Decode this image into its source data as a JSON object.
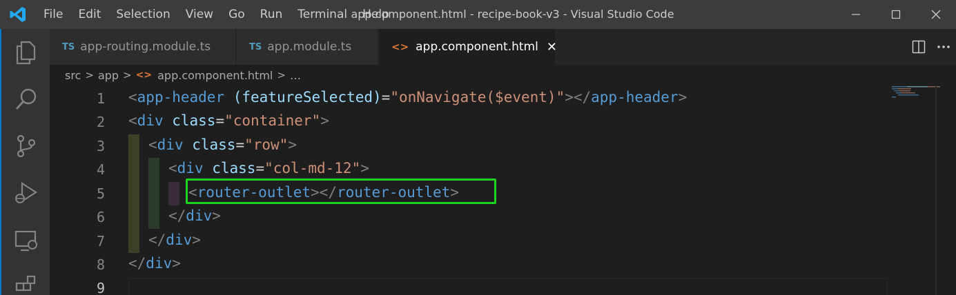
{
  "titlebar": {
    "menu": [
      "File",
      "Edit",
      "Selection",
      "View",
      "Go",
      "Run",
      "Terminal",
      "Help"
    ],
    "window_title": "app.component.html - recipe-book-v3 - Visual Studio Code",
    "controls": [
      "minimize-icon",
      "maximize-icon",
      "close-icon"
    ]
  },
  "activitybar": [
    "explorer-icon",
    "search-icon",
    "source-control-icon",
    "run-debug-icon",
    "remote-explorer-icon",
    "extensions-icon"
  ],
  "tabs": [
    {
      "type": "TS",
      "label": "app-routing.module.ts",
      "active": false
    },
    {
      "type": "TS",
      "label": "app.module.ts",
      "active": false
    },
    {
      "type": "<>",
      "label": "app.component.html",
      "active": true,
      "close": "✕"
    }
  ],
  "breadcrumb": {
    "parts": [
      "src",
      "app",
      "app.component.html",
      "…"
    ],
    "separator": ">"
  },
  "editor": {
    "line_numbers": [
      "1",
      "2",
      "3",
      "4",
      "5",
      "6",
      "7",
      "8",
      "9"
    ],
    "current_line": "9",
    "highlight_color": "#1ed31e",
    "lines": [
      {
        "br_open": "<",
        "tag": "app-header",
        "attr": " (featureSelected)",
        "eq": "=",
        "str": "\"onNavigate($event)\"",
        "br_mid": "></",
        "tag2": "app-header",
        "br_close": ">"
      },
      {
        "br_open": "<",
        "tag": "div",
        "attr": " class",
        "eq": "=",
        "str": "\"container\"",
        "br_close": ">"
      },
      {
        "br_open": "<",
        "tag": "div",
        "attr": " class",
        "eq": "=",
        "str": "\"row\"",
        "br_close": ">"
      },
      {
        "br_open": "<",
        "tag": "div",
        "attr": " class",
        "eq": "=",
        "str": "\"col-md-12\"",
        "br_close": ">"
      },
      {
        "br_open": "<",
        "tag": "router-outlet",
        "br_mid": "></",
        "tag2": "router-outlet",
        "br_close": ">"
      },
      {
        "br_open": "</",
        "tag": "div",
        "br_close": ">"
      },
      {
        "br_open": "</",
        "tag": "div",
        "br_close": ">"
      },
      {
        "br_open": "</",
        "tag": "div",
        "br_close": ">"
      }
    ]
  },
  "colors": {
    "accent": "#007acc",
    "titlebar_bg": "#3c3c3c",
    "editor_bg": "#1e1e1e",
    "tag": "#569cd6",
    "attr": "#9cdcfe",
    "string": "#ce9178"
  }
}
